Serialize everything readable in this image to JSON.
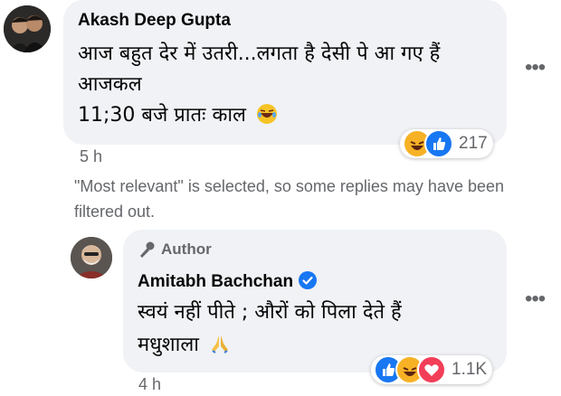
{
  "comment1": {
    "author": "Akash Deep Gupta",
    "line1": "आज बहुत देर में उतरी...लगता है देसी पे आ गए हैं",
    "line2": "आजकल",
    "line3": "11;30 बजे प्रातः काल",
    "time": "5 h",
    "reaction_count": "217",
    "reactions": [
      "haha-icon",
      "like-icon"
    ]
  },
  "filter_notice": "\"Most relevant\" is selected, so some replies may have been filtered out.",
  "reply": {
    "badge": "Author",
    "author": "Amitabh Bachchan",
    "line1": "स्वयं नहीं पीते ; औरों को पिला देते हैं",
    "line2": "मधुशाला",
    "time": "4 h",
    "reaction_count": "1.1K",
    "reactions": [
      "like-icon",
      "haha-icon",
      "love-icon"
    ]
  },
  "colors": {
    "bubble": "#f0f2f5",
    "muted": "#65676b",
    "like": "#1877f2",
    "love": "#f33e58",
    "haha": "#f7b125"
  }
}
